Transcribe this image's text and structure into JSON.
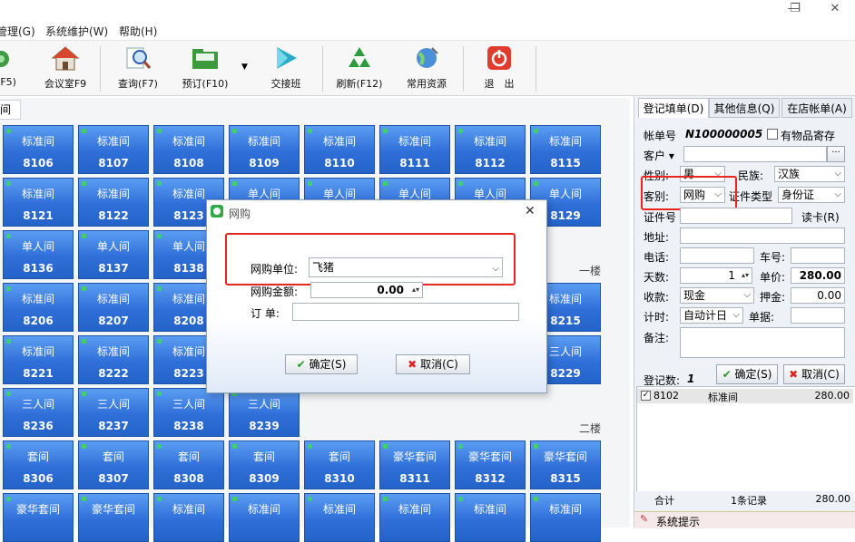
{
  "window": {
    "restore_glyph": "❐",
    "close_glyph": "✕"
  },
  "menu": [
    "管理(G)",
    "系统维护(W)",
    "帮助(H)"
  ],
  "toolbar": {
    "items": [
      {
        "label": "(F5)",
        "icon": "partial-icon"
      },
      {
        "label": "会议室F9",
        "icon": "house-icon"
      },
      {
        "label": "查询(F7)",
        "icon": "magnifier-icon"
      },
      {
        "label": "预订(F10)",
        "icon": "folder-icon"
      },
      {
        "label": "交接班",
        "icon": "play-icon"
      },
      {
        "label": "刷新(F12)",
        "icon": "recycle-icon"
      },
      {
        "label": "常用资源",
        "icon": "globe-icon"
      },
      {
        "label": "退　出",
        "icon": "power-icon"
      }
    ]
  },
  "room_tab_label": "查间",
  "rooms": {
    "row1": [
      {
        "type": "标准间",
        "no": "8106"
      },
      {
        "type": "标准间",
        "no": "8107"
      },
      {
        "type": "标准间",
        "no": "8108"
      },
      {
        "type": "标准间",
        "no": "8109"
      },
      {
        "type": "标准间",
        "no": "8110"
      },
      {
        "type": "标准间",
        "no": "8111"
      },
      {
        "type": "标准间",
        "no": "8112"
      },
      {
        "type": "标准间",
        "no": "8115"
      }
    ],
    "row2": [
      {
        "type": "标准间",
        "no": "8121"
      },
      {
        "type": "标准间",
        "no": "8122"
      },
      {
        "type": "标准间",
        "no": "8123"
      },
      {
        "type": "单人间",
        "no": ""
      },
      {
        "type": "单人间",
        "no": ""
      },
      {
        "type": "单人间",
        "no": ""
      },
      {
        "type": "单人间",
        "no": ""
      },
      {
        "type": "单人间",
        "no": "8129"
      }
    ],
    "row3": [
      {
        "type": "单人间",
        "no": "8136"
      },
      {
        "type": "单人间",
        "no": "8137"
      },
      {
        "type": "单人间",
        "no": "8138"
      }
    ],
    "row4": [
      {
        "type": "标准间",
        "no": "8206"
      },
      {
        "type": "标准间",
        "no": "8207"
      },
      {
        "type": "标准间",
        "no": "8208"
      },
      {
        "type": "标准间",
        "no": "8215"
      }
    ],
    "row5": [
      {
        "type": "标准间",
        "no": "8221"
      },
      {
        "type": "标准间",
        "no": "8222"
      },
      {
        "type": "标准间",
        "no": "8223"
      },
      {
        "type": "三人间",
        "no": "8229"
      }
    ],
    "row6": [
      {
        "type": "三人间",
        "no": "8236"
      },
      {
        "type": "三人间",
        "no": "8237"
      },
      {
        "type": "三人间",
        "no": "8238"
      },
      {
        "type": "三人间",
        "no": "8239"
      }
    ],
    "row7": [
      {
        "type": "套间",
        "no": "8306"
      },
      {
        "type": "套间",
        "no": "8307"
      },
      {
        "type": "套间",
        "no": "8308"
      },
      {
        "type": "套间",
        "no": "8309"
      },
      {
        "type": "套间",
        "no": "8310"
      },
      {
        "type": "豪华套间",
        "no": "8311"
      },
      {
        "type": "豪华套间",
        "no": "8312"
      },
      {
        "type": "豪华套间",
        "no": "8315"
      }
    ],
    "row8": [
      {
        "type": "豪华套间",
        "no": ""
      },
      {
        "type": "豪华套间",
        "no": ""
      },
      {
        "type": "标准间",
        "no": ""
      },
      {
        "type": "标准间",
        "no": ""
      },
      {
        "type": "标准间",
        "no": ""
      },
      {
        "type": "标准间",
        "no": ""
      },
      {
        "type": "标准间",
        "no": ""
      },
      {
        "type": "标准间",
        "no": ""
      }
    ]
  },
  "floors": {
    "floor1": "一楼",
    "floor2": "二楼"
  },
  "right_panel": {
    "tabs": [
      "登记填单(D)",
      "其他信息(Q)",
      "在店帐单(A)"
    ],
    "account_label": "帐单号",
    "account_no": "N100000005",
    "valuables_label": "有物品寄存",
    "customer_label": "客户",
    "customer_more": "···",
    "gender_label": "性别:",
    "gender_value": "男",
    "ethnic_label": "民族:",
    "ethnic_value": "汉族",
    "guest_type_label": "客别:",
    "guest_type_value": "网购",
    "id_type_label": "证件类型",
    "id_type_value": "身份证",
    "id_no_label": "证件号",
    "read_card": "读卡(R)",
    "address_label": "地址:",
    "phone_label": "电话:",
    "plate_label": "车号:",
    "days_label": "天数:",
    "days_value": "1",
    "price_label": "单价:",
    "price_value": "280.00",
    "fee_label": "收款:",
    "fee_value": "现金",
    "deposit_label": "押金:",
    "deposit_value": "0.00",
    "timing_label": "计时:",
    "timing_value": "自动计日",
    "receipt_label": "单据:",
    "remark_label": "备注:",
    "reg_count_label": "登记数:",
    "reg_count_value": "1",
    "confirm": "确定(S)",
    "cancel": "取消(C)",
    "list_row": {
      "room": "8102",
      "type": "标准间",
      "amount": "280.00"
    },
    "summary_label": "合计",
    "summary_count": "1条记录",
    "summary_amount": "280.00",
    "sys_tip": "系统提示"
  },
  "dialog": {
    "title": "网购",
    "unit_label": "网购单位:",
    "unit_value": "飞猪",
    "amount_label": "网购金额:",
    "amount_value": "0.00",
    "order_label": "订 单:",
    "order_value": "",
    "ok": "确定(S)",
    "cancel": "取消(C)"
  },
  "colors": {
    "room_blue": "#2f6fd8",
    "highlight_red": "#e8261f"
  }
}
